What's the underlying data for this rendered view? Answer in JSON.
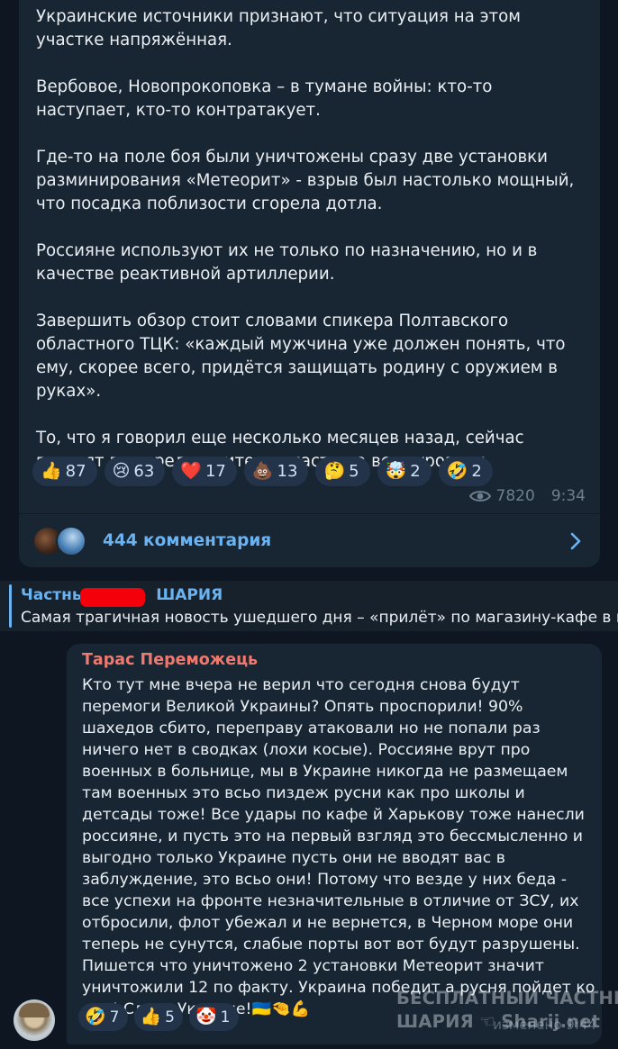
{
  "post": {
    "paragraphs": [
      "Украинские источники признают, что ситуация на этом участке напряжённая.",
      "Вербовое, Новопрокоповка – в тумане войны: кто-то наступает, кто-то контратакует.",
      "Где-то на поле боя были уничтожены сразу две установки разминирования «Метеорит» - взрыв был настолько мощный, что посадка поблизости сгорела дотла.",
      "Россияне используют их не только по назначению, но и в качестве реактивной артиллерии.",
      "Завершить обзор стоит словами спикера Полтавского областного ТЦК: «каждый мужчина уже должен понять, что ему, скорее всего, придётся защищать родину с оружием в руках».",
      "То, что я говорил еще несколько месяцев назад, сейчас говорят все представители власти на всех уровнях"
    ],
    "reactions": [
      {
        "emoji": "👍",
        "count": "87"
      },
      {
        "emoji": "😢",
        "count": "63"
      },
      {
        "emoji": "❤️",
        "count": "17"
      },
      {
        "emoji": "💩",
        "count": "13"
      },
      {
        "emoji": "🤔",
        "count": "5"
      },
      {
        "emoji": "🤯",
        "count": "2"
      },
      {
        "emoji": "🤣",
        "count": "2"
      }
    ],
    "views": "7820",
    "time": "9:34",
    "comments_label": "444 комментария"
  },
  "reply_quote": {
    "title_before": "Частны",
    "title_after": "ШАРИЯ",
    "snippet": "Самая трагичная новость ушедшего дня – «прилёт» по магазину-кафе в посё"
  },
  "comment": {
    "author": "Тарас Переможець",
    "text": "Кто тут мне вчера не верил что сегодня снова будут перемоги Великой Украины? Опять проспорили!  90% шахедов сбито, переправу атаковали но не попали раз ничего нет в сводках (лохи косые). Россияне врут про военных в больнице, мы в Украине никогда не размещаем там военных это всьо пиздеж русни как про школы и детсады тоже! Все удары по кафе й Харькову тоже нанесли россияне, и пусть это на первый взгляд это бессмысленно и выгодно только Украине пусть они не вводят вас в заблуждение, это всьо они! Потому что везде у них беда - все успехи на фронте незначительные в отличие от ЗСУ, их отбросили, флот убежал и не вернется, в  Черном море они теперь не сунутся, слабые порты вот вот будут разрушены. Пишется что уничтожено 2 установки Метеорит значит уничтожили 12 по факту. Украина победит а русня пойдет ко дну! Слава Украине!🇺🇦🤏💪",
    "reactions": [
      {
        "emoji": "🤣",
        "count": "7"
      },
      {
        "emoji": "👍",
        "count": "5"
      },
      {
        "emoji": "🤡",
        "count": "1"
      }
    ],
    "edited": "изменено 9:44"
  },
  "watermark": {
    "line1": "БЕСПЛАТНЫЙ  ЧАСТНЫЙ",
    "line2": "ШАРИЯ",
    "line2_tail": "Sharij.net"
  },
  "colors": {
    "background": "#0e1621",
    "bubble": "#182533",
    "link": "#6ab3f3",
    "author": "#ee7a6f",
    "redaction": "#f4000b"
  }
}
